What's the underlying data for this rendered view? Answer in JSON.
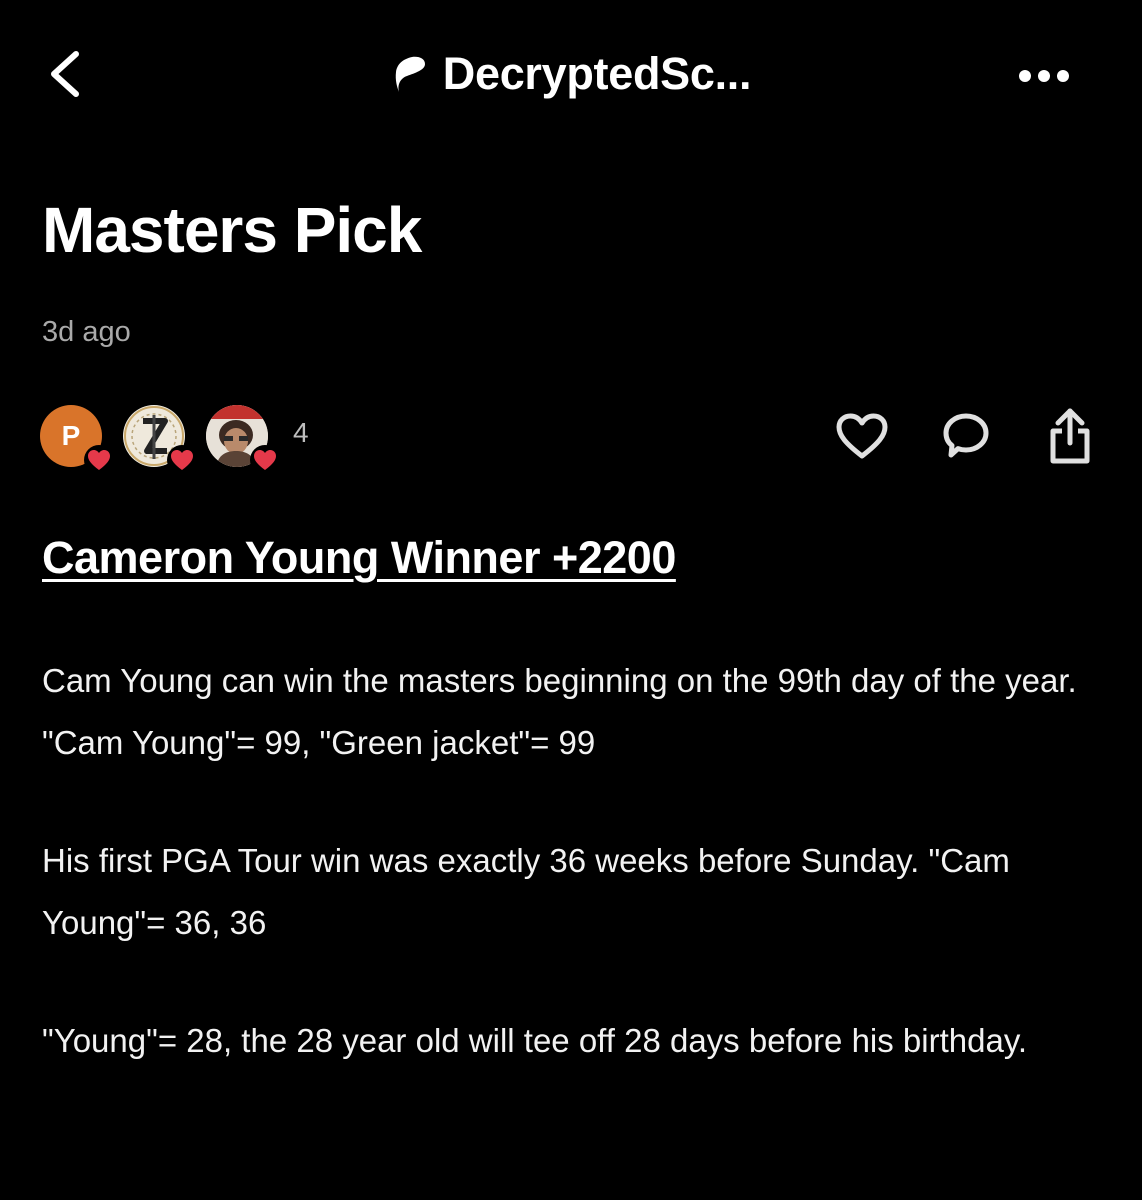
{
  "nav": {
    "title": "DecryptedSc...",
    "back_icon": "chevron-left-icon",
    "logo_icon": "patreon-logo-icon",
    "more_icon": "more-dots-icon"
  },
  "post": {
    "title": "Masters Pick",
    "date": "3d ago",
    "likers": [
      {
        "initial": "P",
        "color": "#d9742a"
      },
      {
        "initial": "",
        "color": "#f1ede2"
      },
      {
        "initial": "",
        "color": "#c9b8a5"
      }
    ],
    "like_count": "4",
    "actions": [
      "heart-icon",
      "comment-icon",
      "share-icon"
    ],
    "headline": "Cameron Young Winner +2200",
    "paragraphs": [
      "Cam Young can win the masters beginning on the 99th day of the year. \"Cam Young\"= 99, \"Green jacket\"= 99",
      "His first PGA Tour win was exactly 36 weeks before Sunday. \"Cam Young\"= 36, 36",
      "\"Young\"= 28, the 28 year old will tee off 28 days before his birthday."
    ]
  },
  "colors": {
    "background": "#000000",
    "text": "#ffffff",
    "muted": "#a9a9a9",
    "heart_badge": "#e5394a"
  }
}
